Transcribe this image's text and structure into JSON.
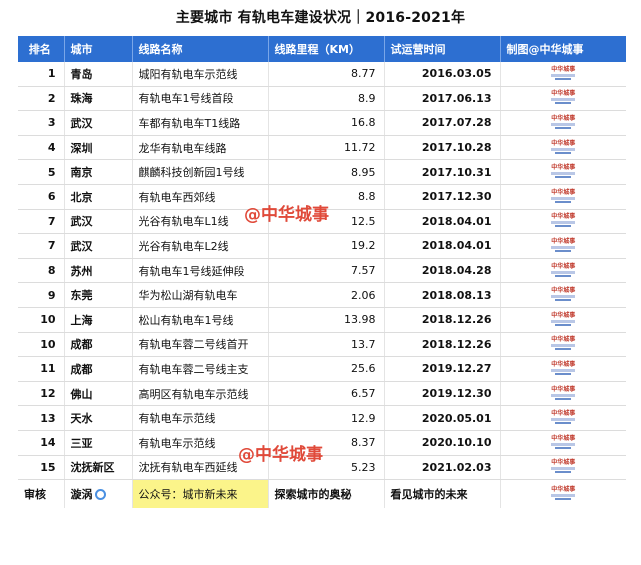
{
  "title": "主要城市 有轨电车建设状况｜2016-2021年",
  "headers": {
    "rank": "排名",
    "city": "城市",
    "line": "线路名称",
    "length": "线路里程（KM）",
    "date": "试运营时间",
    "credit": "制图@中华城事"
  },
  "logo_text": "中华城事",
  "rows": [
    {
      "rank": "1",
      "city": "青岛",
      "line": "城阳有轨电车示范线",
      "length": "8.77",
      "date": "2016.03.05"
    },
    {
      "rank": "2",
      "city": "珠海",
      "line": "有轨电车1号线首段",
      "length": "8.9",
      "date": "2017.06.13"
    },
    {
      "rank": "3",
      "city": "武汉",
      "line": "车都有轨电车T1线路",
      "length": "16.8",
      "date": "2017.07.28"
    },
    {
      "rank": "4",
      "city": "深圳",
      "line": "龙华有轨电车线路",
      "length": "11.72",
      "date": "2017.10.28"
    },
    {
      "rank": "5",
      "city": "南京",
      "line": "麒麟科技创新园1号线",
      "length": "8.95",
      "date": "2017.10.31"
    },
    {
      "rank": "6",
      "city": "北京",
      "line": "有轨电车西郊线",
      "length": "8.8",
      "date": "2017.12.30"
    },
    {
      "rank": "7",
      "city": "武汉",
      "line": "光谷有轨电车L1线",
      "length": "12.5",
      "date": "2018.04.01"
    },
    {
      "rank": "7",
      "city": "武汉",
      "line": "光谷有轨电车L2线",
      "length": "19.2",
      "date": "2018.04.01"
    },
    {
      "rank": "8",
      "city": "苏州",
      "line": "有轨电车1号线延伸段",
      "length": "7.57",
      "date": "2018.04.28"
    },
    {
      "rank": "9",
      "city": "东莞",
      "line": "华为松山湖有轨电车",
      "length": "2.06",
      "date": "2018.08.13"
    },
    {
      "rank": "10",
      "city": "上海",
      "line": "松山有轨电车1号线",
      "length": "13.98",
      "date": "2018.12.26"
    },
    {
      "rank": "10",
      "city": "成都",
      "line": "有轨电车蓉二号线首开",
      "length": "13.7",
      "date": "2018.12.26"
    },
    {
      "rank": "11",
      "city": "成都",
      "line": "有轨电车蓉二号线主支",
      "length": "25.6",
      "date": "2019.12.27"
    },
    {
      "rank": "12",
      "city": "佛山",
      "line": "高明区有轨电车示范线",
      "length": "6.57",
      "date": "2019.12.30"
    },
    {
      "rank": "13",
      "city": "天水",
      "line": "有轨电车示范线",
      "length": "12.9",
      "date": "2020.05.01"
    },
    {
      "rank": "14",
      "city": "三亚",
      "line": "有轨电车示范线",
      "length": "8.37",
      "date": "2020.10.10"
    },
    {
      "rank": "15",
      "city": "沈抚新区",
      "line": "沈抚有轨电车西延线",
      "length": "5.23",
      "date": "2021.02.03"
    }
  ],
  "footer": {
    "reviewer_label": "审核",
    "reviewer_name": "漩涡",
    "account": "公众号：城市新未来",
    "slogan1": "探索城市的奥秘",
    "slogan2": "看见城市的未来"
  },
  "watermarks": [
    "@中华城事",
    "@中华城事"
  ],
  "colors": {
    "header_bg": "#2d6fd1",
    "highlight": "#fbf48a",
    "watermark": "#e04a3a"
  }
}
